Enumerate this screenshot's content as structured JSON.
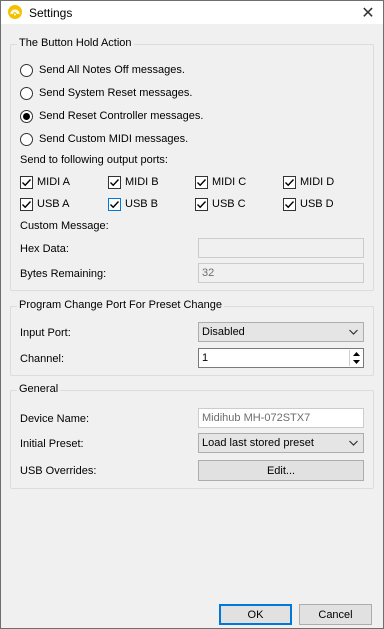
{
  "window": {
    "title": "Settings",
    "close_glyph": "✕",
    "icon_name": "app-icon",
    "accent_color": "#f2c200"
  },
  "button_hold": {
    "title": "The Button Hold Action",
    "options": [
      {
        "label": "Send All Notes Off messages.",
        "checked": false
      },
      {
        "label": "Send System Reset messages.",
        "checked": false
      },
      {
        "label": "Send Reset Controller messages.",
        "checked": true
      },
      {
        "label": "Send Custom MIDI messages.",
        "checked": false
      }
    ],
    "ports_label": "Send to following output ports:",
    "ports": [
      {
        "label": "MIDI A",
        "checked": true
      },
      {
        "label": "MIDI B",
        "checked": true
      },
      {
        "label": "MIDI C",
        "checked": true
      },
      {
        "label": "MIDI D",
        "checked": true
      },
      {
        "label": "USB A",
        "checked": true
      },
      {
        "label": "USB B",
        "checked": true
      },
      {
        "label": "USB C",
        "checked": true
      },
      {
        "label": "USB D",
        "checked": true
      }
    ],
    "custom_message_label": "Custom Message:",
    "hex_data_label": "Hex Data:",
    "hex_data_value": "",
    "bytes_remaining_label": "Bytes Remaining:",
    "bytes_remaining_value": "32"
  },
  "program_change": {
    "title": "Program Change Port For Preset Change",
    "input_port_label": "Input Port:",
    "input_port_value": "Disabled",
    "channel_label": "Channel:",
    "channel_value": "1"
  },
  "general": {
    "title": "General",
    "device_name_label": "Device Name:",
    "device_name_value": "Midihub MH-072STX7",
    "initial_preset_label": "Initial Preset:",
    "initial_preset_value": "Load last stored preset",
    "usb_overrides_label": "USB Overrides:",
    "edit_button": "Edit..."
  },
  "footer": {
    "ok": "OK",
    "cancel": "Cancel"
  }
}
